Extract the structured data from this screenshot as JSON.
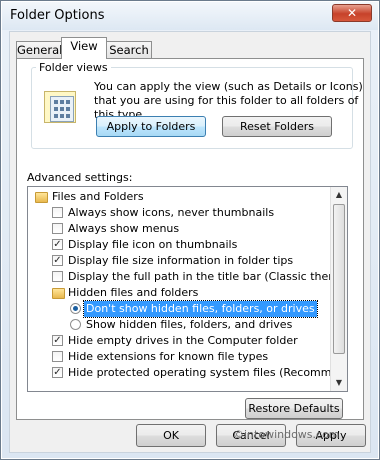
{
  "window": {
    "title": "Folder Options",
    "close_glyph": "✕"
  },
  "tabs": [
    {
      "label": "General"
    },
    {
      "label": "View"
    },
    {
      "label": "Search"
    }
  ],
  "folder_views": {
    "group_label": "Folder views",
    "description": "You can apply the view (such as Details or Icons) that you are using for this folder to all folders of this type.",
    "apply_button": "Apply to Folders",
    "reset_button": "Reset Folders"
  },
  "advanced": {
    "label": "Advanced settings:",
    "items": [
      {
        "type": "folder",
        "label": "Files and Folders"
      },
      {
        "type": "checkbox",
        "label": "Always show icons, never thumbnails",
        "checked": false
      },
      {
        "type": "checkbox",
        "label": "Always show menus",
        "checked": false
      },
      {
        "type": "checkbox",
        "label": "Display file icon on thumbnails",
        "checked": true
      },
      {
        "type": "checkbox",
        "label": "Display file size information in folder tips",
        "checked": true
      },
      {
        "type": "checkbox",
        "label": "Display the full path in the title bar (Classic theme only)",
        "checked": false
      },
      {
        "type": "folder",
        "label": "Hidden files and folders"
      },
      {
        "type": "radio",
        "label": "Don't show hidden files, folders, or drives",
        "checked": true,
        "selected": true
      },
      {
        "type": "radio",
        "label": "Show hidden files, folders, and drives",
        "checked": false
      },
      {
        "type": "checkbox",
        "label": "Hide empty drives in the Computer folder",
        "checked": true
      },
      {
        "type": "checkbox",
        "label": "Hide extensions for known file types",
        "checked": false
      },
      {
        "type": "checkbox",
        "label": "Hide protected operating system files (Recommended)",
        "checked": true
      }
    ],
    "restore_button": "Restore Defaults"
  },
  "dialog_buttons": {
    "ok": "OK",
    "cancel": "Cancel",
    "apply": "Apply"
  },
  "watermark": "©intowindows.com",
  "colors": {
    "selection": "#3399ff",
    "default_button": "#a7d9f5",
    "close_button": "#c7422a"
  }
}
